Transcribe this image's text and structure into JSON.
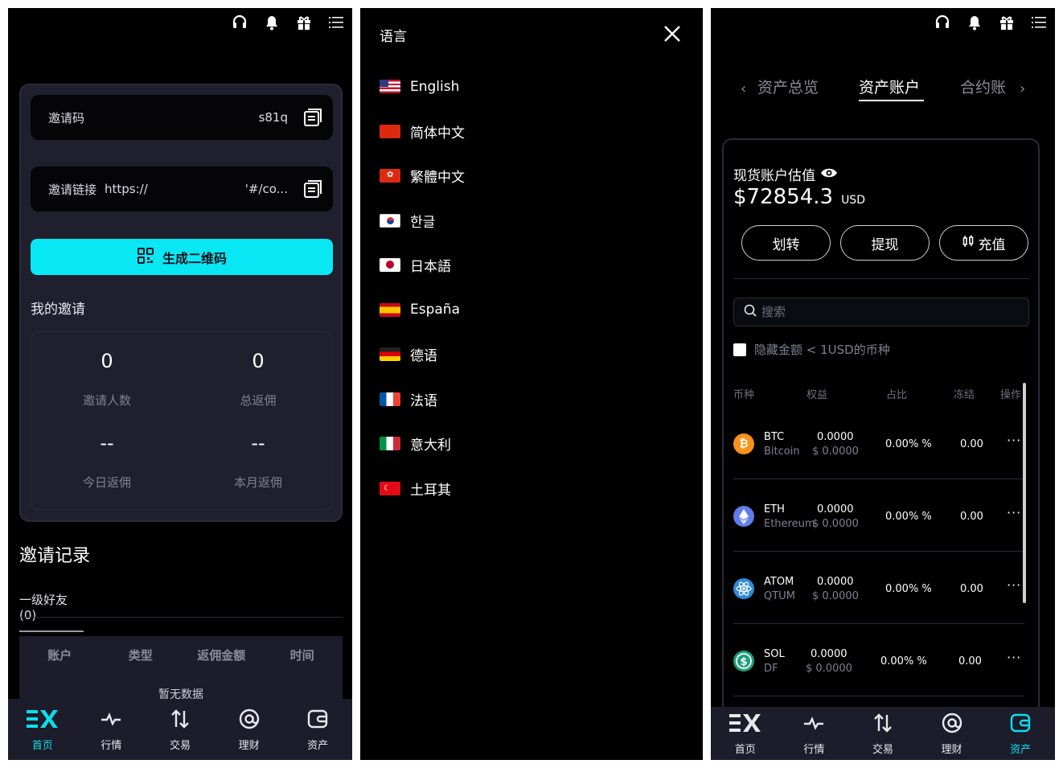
{
  "panel1": {
    "invite_code_label": "邀请码",
    "invite_code_value": "s81q",
    "invite_link_label": "邀请链接",
    "invite_link_url": "https://",
    "invite_link_suffix": "'#/co...",
    "generate_qr": "生成二维码",
    "my_invites": "我的邀请",
    "stats": [
      {
        "value": "0",
        "label": "邀请人数"
      },
      {
        "value": "0",
        "label": "总返佣"
      },
      {
        "value": "--",
        "label": "今日返佣"
      },
      {
        "value": "--",
        "label": "本月返佣"
      }
    ],
    "records_title": "邀请记录",
    "friends_tab": "一级好友(0)",
    "table_headers": [
      "账户",
      "类型",
      "返佣金额",
      "时间"
    ],
    "no_data": "暂无数据"
  },
  "nav": {
    "items": [
      "首页",
      "行情",
      "交易",
      "理财",
      "资产"
    ]
  },
  "panel2": {
    "title": "语言",
    "languages": [
      "English",
      "简体中文",
      "繁體中文",
      "한글",
      "日本語",
      "España",
      "德语",
      "法语",
      "意大利",
      "土耳其"
    ]
  },
  "panel3": {
    "tabs": [
      "资产总览",
      "资产账户",
      "合约账"
    ],
    "estimate_label": "现货账户估值",
    "estimate_value": "$72854.3",
    "estimate_unit": "USD",
    "actions": [
      "划转",
      "提现",
      "充值"
    ],
    "search_placeholder": "搜索",
    "hide_small": "隐藏金额 < 1USD的币种",
    "headers": [
      "币种",
      "权益",
      "占比",
      "冻结",
      "操作"
    ],
    "rows": [
      {
        "symbol": "BTC",
        "name": "Bitcoin",
        "amount": "0.0000",
        "usd": "$ 0.0000",
        "pct": "0.00% %",
        "frozen": "0.00",
        "color": "#f7931a"
      },
      {
        "symbol": "ETH",
        "name": "Ethereum",
        "amount": "0.0000",
        "usd": "$ 0.0000",
        "pct": "0.00% %",
        "frozen": "0.00",
        "color": "#627eea"
      },
      {
        "symbol": "ATOM",
        "name": "QTUM",
        "amount": "0.0000",
        "usd": "$ 0.0000",
        "pct": "0.00% %",
        "frozen": "0.00",
        "color": "#2e8bd6"
      },
      {
        "symbol": "SOL",
        "name": "DF",
        "amount": "0.0000",
        "usd": "$ 0.0000",
        "pct": "0.00% %",
        "frozen": "0.00",
        "color": "#1ba27a"
      }
    ],
    "more_glyph": "···"
  },
  "colors": {
    "accent": "#08e8f4",
    "card_bg": "#1f1f2e",
    "nav_bg": "#1c1c2a"
  },
  "icons": [
    "headset-icon",
    "bell-icon",
    "gift-icon",
    "menu-list-icon",
    "copy-icon",
    "qr-icon",
    "close-icon",
    "eye-icon",
    "search-icon"
  ]
}
